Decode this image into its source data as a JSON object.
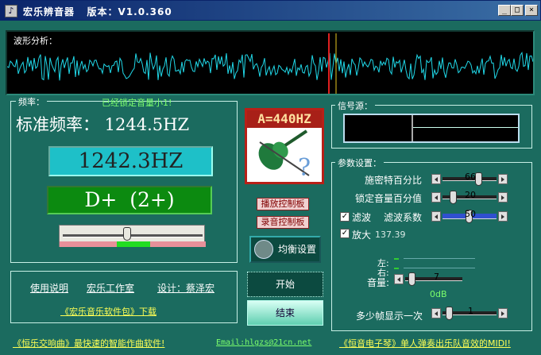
{
  "window": {
    "title": "宏乐辨音器   版本：V1.0.360",
    "minimize": "_",
    "maximize": "□",
    "close": "×"
  },
  "wave": {
    "label": "波形分析："
  },
  "frequency": {
    "group_title": "频率：",
    "lock_note": "已经锁定音量小1!",
    "standard_label": "标准频率： 1244.5HZ",
    "measured": "1242.3HZ",
    "note": "D+  (2+)"
  },
  "links": {
    "manual": "使用说明",
    "studio": "宏乐工作室",
    "designer": "设计：蔡泽宏",
    "package": "《宏乐音乐软件包》下载",
    "footer_left": "《恒乐交响曲》最快速的智能作曲软件!",
    "email": "Email:hlgzs@21cn.net",
    "footer_right": "《恒音电子琴》单人弹奏出乐队音效的MIDI!"
  },
  "logo": {
    "text": "A=440HZ"
  },
  "buttons": {
    "playback_panel": "播放控制板",
    "record_panel": "录音控制板",
    "equalizer": "均衡设置",
    "start": "开始",
    "stop": "结束"
  },
  "signal": {
    "group_title": "信号源："
  },
  "params": {
    "group_title": "参数设置：",
    "schmitt_label": "施密特百分比",
    "schmitt_value": "66",
    "lock_volume_label": "锁定音量百分值",
    "lock_volume_value": "20",
    "filter_label": "滤波",
    "filter_checked": true,
    "filter_coef_label": "滤波系数",
    "filter_coef_value": "50",
    "amplify_label": "放大",
    "amplify_checked": true,
    "amplify_value": "137.39",
    "left_label": "左:",
    "right_label": "右:",
    "volume_label": "音量:",
    "volume_value": "7",
    "db_value": "0dB",
    "frames_label": "多少帧显示一次",
    "frames_value": "1"
  },
  "colors": {
    "background": "#1b6b5f",
    "freq_box": "#1ec0c8",
    "note_box": "#0c8a10",
    "link_yellow": "#ffff55"
  }
}
